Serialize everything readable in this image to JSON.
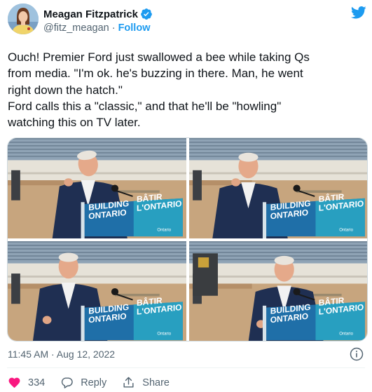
{
  "author": {
    "display_name": "Meagan Fitzpatrick",
    "handle": "@fitz_meagan",
    "separator": "·",
    "follow_label": "Follow",
    "verified": true
  },
  "tweet": {
    "lines": [
      "Ouch! Premier Ford just swallowed a bee while taking Qs",
      "from media. \"I'm ok. he's buzzing in there. Man, he went",
      "right down the hatch.\"",
      "Ford calls this a \"classic,\" and that he'll be \"howling\"",
      "watching this on TV later."
    ]
  },
  "media": {
    "photos": [
      {
        "id": "photo-1",
        "sign_left": "BUILDING\nONTARIO",
        "sign_right": "BÂTIR\nL'ONTARIO",
        "sign_brand": "Ontario"
      },
      {
        "id": "photo-2",
        "sign_left": "BUILDING\nONTARIO",
        "sign_right": "BÂTIR\nL'ONTARIO",
        "sign_brand": "Ontario"
      },
      {
        "id": "photo-3",
        "sign_left": "BUILDING\nONTARIO",
        "sign_right": "BÂTIR\nL'ONTARIO",
        "sign_brand": "Ontario"
      },
      {
        "id": "photo-4",
        "sign_left": "BUILDING\nONTARIO",
        "sign_right": "BÂTIR\nL'ONTARIO",
        "sign_brand": "Ontario"
      }
    ]
  },
  "footer": {
    "timestamp": "11:45 AM · Aug 12, 2022",
    "like_count": "334",
    "reply_label": "Reply",
    "share_label": "Share"
  },
  "colors": {
    "accent": "#1d9bf0",
    "text": "#0f1419",
    "secondary": "#536471",
    "sign_blue": "#1f6fa8",
    "sign_teal": "#2aa8c4"
  },
  "icons": [
    "avatar",
    "verified-badge-icon",
    "twitter-bird-icon",
    "info-icon",
    "heart-icon",
    "reply-icon",
    "share-icon"
  ]
}
